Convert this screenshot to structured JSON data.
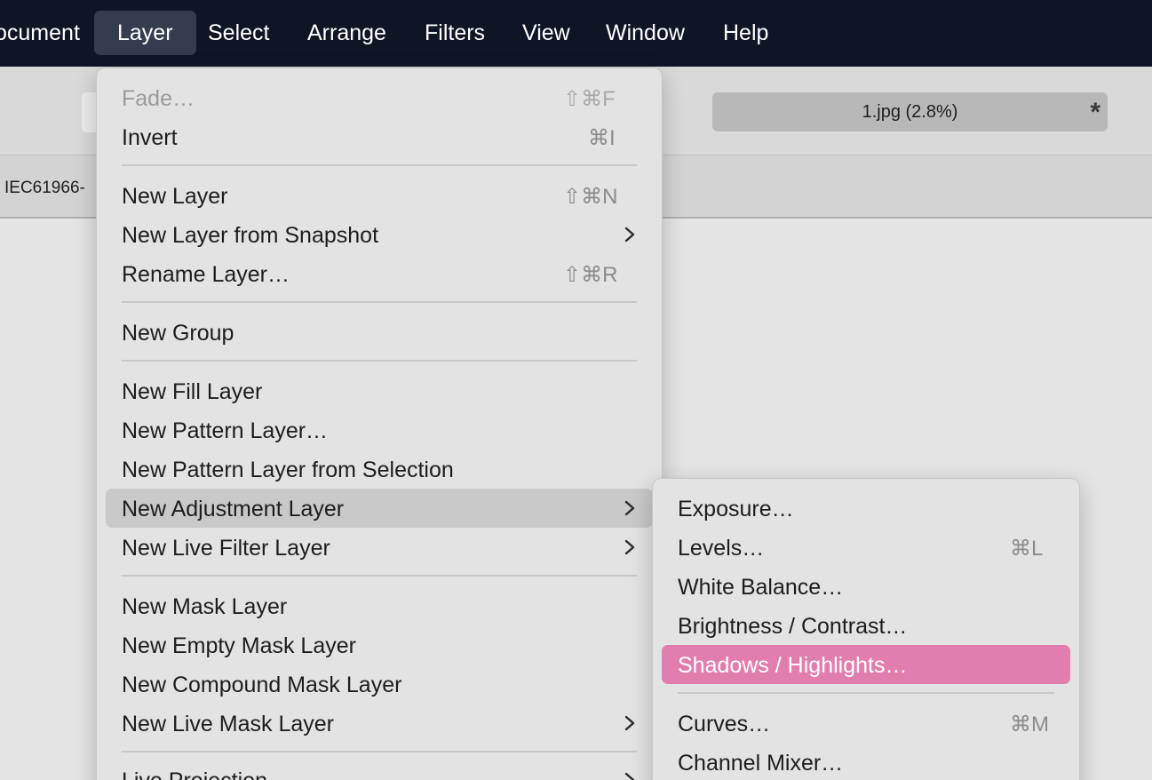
{
  "menubar": {
    "items": [
      {
        "label": "ocument"
      },
      {
        "label": "Layer"
      },
      {
        "label": "Select"
      },
      {
        "label": "Arrange"
      },
      {
        "label": "Filters"
      },
      {
        "label": "View"
      },
      {
        "label": "Window"
      },
      {
        "label": "Help"
      }
    ]
  },
  "document": {
    "title": "1.jpg (2.8%)",
    "modified_marker": "*",
    "tab_label": "IEC61966-"
  },
  "layer_menu": {
    "items": [
      {
        "label": "Fade…",
        "shortcut": "⇧⌘F"
      },
      {
        "label": "Invert",
        "shortcut": "⌘I"
      },
      {
        "label": "New Layer",
        "shortcut": "⇧⌘N"
      },
      {
        "label": "New Layer from Snapshot"
      },
      {
        "label": "Rename Layer…",
        "shortcut": "⇧⌘R"
      },
      {
        "label": "New Group"
      },
      {
        "label": "New Fill Layer"
      },
      {
        "label": "New Pattern Layer…"
      },
      {
        "label": "New Pattern Layer from Selection"
      },
      {
        "label": "New Adjustment Layer"
      },
      {
        "label": "New Live Filter Layer"
      },
      {
        "label": "New Mask Layer"
      },
      {
        "label": "New Empty Mask Layer"
      },
      {
        "label": "New Compound Mask Layer"
      },
      {
        "label": "New Live Mask Layer"
      },
      {
        "label": "Live Projection"
      }
    ]
  },
  "adjustment_submenu": {
    "items": [
      {
        "label": "Exposure…"
      },
      {
        "label": "Levels…",
        "shortcut": "⌘L"
      },
      {
        "label": "White Balance…"
      },
      {
        "label": "Brightness / Contrast…"
      },
      {
        "label": "Shadows / Highlights…"
      },
      {
        "label": "Curves…",
        "shortcut": "⌘M"
      },
      {
        "label": "Channel Mixer…"
      }
    ]
  },
  "colors": {
    "menubar_bg": "#0f1525",
    "selected_item": "#e17ead",
    "hover_item": "#c9c9c9"
  }
}
